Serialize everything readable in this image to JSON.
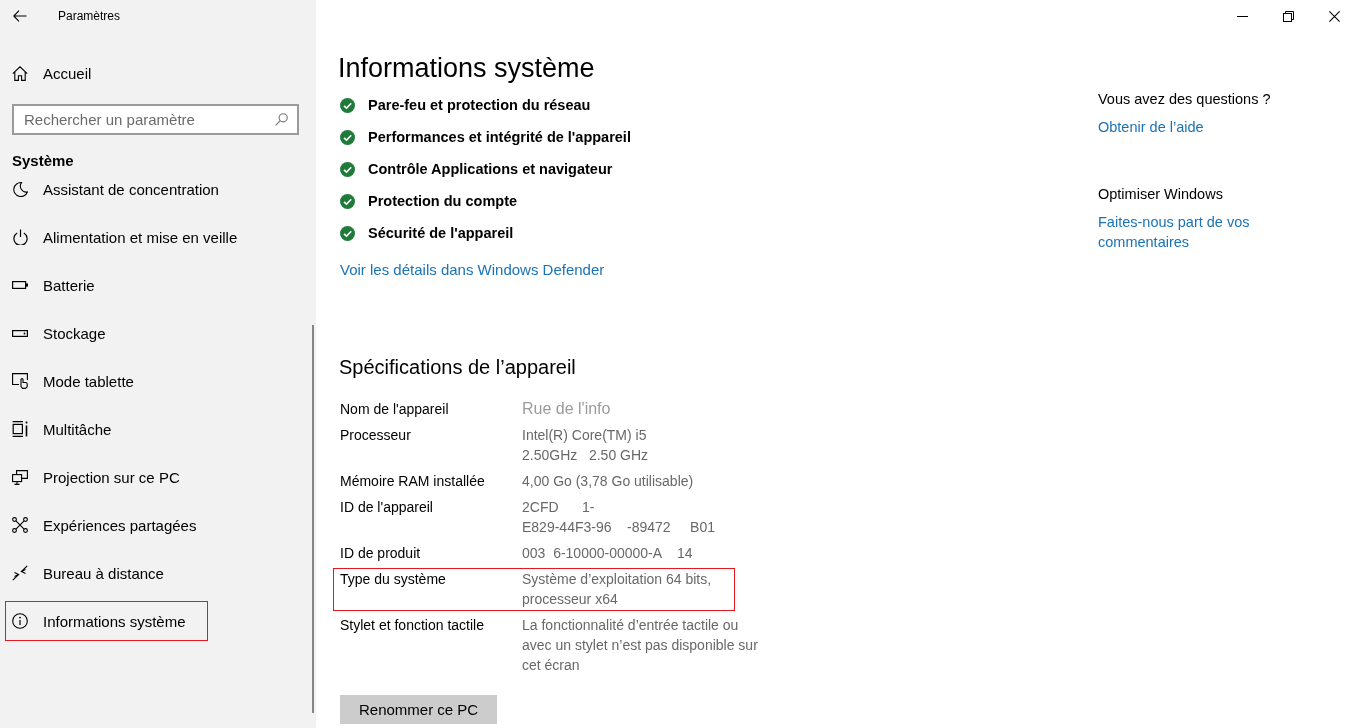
{
  "window": {
    "title": "Paramètres"
  },
  "sidebar": {
    "home": "Accueil",
    "search": {
      "placeholder": "Rechercher un paramètre"
    },
    "section": "Système",
    "items": [
      {
        "label": "Assistant de concentration",
        "highlighted": false
      },
      {
        "label": "Alimentation et mise en veille",
        "highlighted": false
      },
      {
        "label": "Batterie",
        "highlighted": false
      },
      {
        "label": "Stockage",
        "highlighted": false
      },
      {
        "label": "Mode tablette",
        "highlighted": false
      },
      {
        "label": "Multitâche",
        "highlighted": false
      },
      {
        "label": "Projection sur ce PC",
        "highlighted": false
      },
      {
        "label": "Expériences partagées",
        "highlighted": false
      },
      {
        "label": "Bureau à distance",
        "highlighted": false
      },
      {
        "label": "Informations système",
        "highlighted": true
      }
    ]
  },
  "page": {
    "title": "Informations système",
    "protections": [
      {
        "label": "Pare-feu et protection du réseau",
        "ok": true
      },
      {
        "label": "Performances et intégrité de l'appareil",
        "ok": true
      },
      {
        "label": "Contrôle Applications et navigateur",
        "ok": true
      },
      {
        "label": "Protection du compte",
        "ok": true
      },
      {
        "label": "Sécurité de l'appareil",
        "ok": true
      }
    ],
    "defender_link": "Voir les détails dans Windows Defender",
    "specs": {
      "title": "Spécifications de l’appareil",
      "rows": [
        {
          "label": "Nom de l'appareil",
          "lines": [
            "Rue de l'info"
          ],
          "kind": "name",
          "highlighted": false
        },
        {
          "label": "Processeur",
          "lines": [
            "Intel(R) Core(TM) i5",
            "2.50GHz   2.50 GHz"
          ],
          "kind": "text",
          "highlighted": false
        },
        {
          "label": "Mémoire RAM installée",
          "lines": [
            "4,00 Go (3,78 Go utilisable)"
          ],
          "kind": "text",
          "highlighted": false
        },
        {
          "label": "ID de l'appareil",
          "lines": [
            "2CFD      1-",
            "E829-44F3-96    -89472     B01"
          ],
          "kind": "text",
          "highlighted": false
        },
        {
          "label": "ID de produit",
          "lines": [
            "003  6-10000-00000-A    14"
          ],
          "kind": "text",
          "highlighted": false
        },
        {
          "label": "Type du système",
          "lines": [
            "Système d’exploitation 64 bits,",
            "processeur x64"
          ],
          "kind": "text",
          "highlighted": true
        },
        {
          "label": "Stylet et fonction tactile",
          "lines": [
            "La fonctionnalité d’entrée tactile ou",
            "avec un stylet n’est pas disponible sur",
            "cet écran"
          ],
          "kind": "text",
          "highlighted": false
        }
      ]
    },
    "rename_button": "Renommer ce PC"
  },
  "aside": {
    "sections": [
      {
        "heading": "Vous avez des questions ?",
        "link": "Obtenir de l’aide"
      },
      {
        "heading": "Optimiser Windows",
        "link": "Faites-nous part de vos commentaires"
      }
    ]
  }
}
